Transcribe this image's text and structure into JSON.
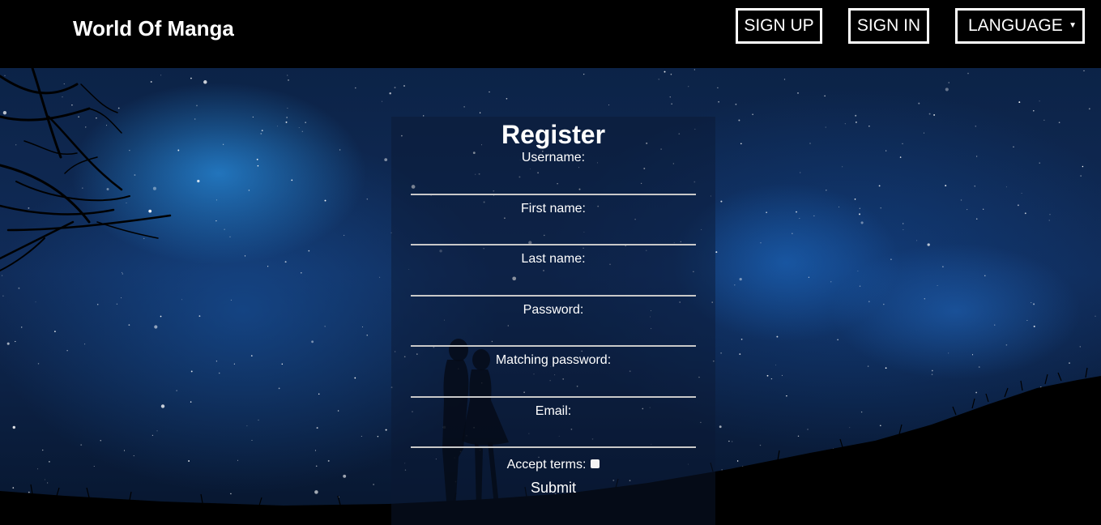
{
  "header": {
    "brand": "World Of Manga",
    "sign_up_label": "SIGN UP",
    "sign_in_label": "SIGN IN",
    "language_label": "LANGUAGE",
    "language_arrow": "▼"
  },
  "register": {
    "title": "Register",
    "fields": [
      {
        "label": "Username:",
        "value": ""
      },
      {
        "label": "First name:",
        "value": ""
      },
      {
        "label": "Last name:",
        "value": ""
      },
      {
        "label": "Password:",
        "value": ""
      },
      {
        "label": "Matching password:",
        "value": ""
      },
      {
        "label": "Email:",
        "value": ""
      }
    ],
    "accept_terms_label": "Accept terms:",
    "accept_terms_checked": false,
    "submit_label": "Submit"
  },
  "colors": {
    "navbar": "#000000",
    "sky": "#102b58",
    "text": "#ffffff",
    "input_underline": "#c9c9c9"
  }
}
